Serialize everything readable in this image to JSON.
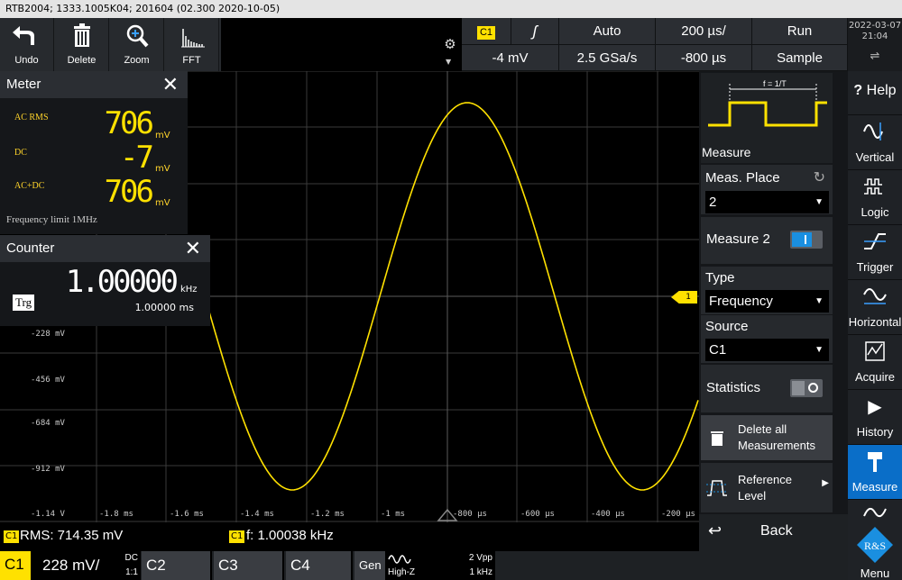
{
  "titlebar": {
    "text": "RTB2004; 1333.1005K04; 201604 (02.300 2020-10-05)"
  },
  "toolbar": {
    "undo": "Undo",
    "delete": "Delete",
    "zoom": "Zoom",
    "fft": "FFT"
  },
  "settings": {
    "channel": "C1",
    "slope_icon": "rising-edge-icon",
    "trigger_mode": "Auto",
    "timebase": "200 µs/",
    "run_state": "Run",
    "trigger_level": "-4 mV",
    "sample_rate": "2.5 GSa/s",
    "horizontal_position": "-800 µs",
    "acquire_mode": "Sample"
  },
  "datetime": {
    "date": "2022-03-07",
    "time": "21:04"
  },
  "grid": {
    "y_labels": [
      "-228 mV",
      "-456 mV",
      "-684 mV",
      "-912 mV",
      "-1.14 V"
    ],
    "x_labels": [
      "-1.8 ms",
      "-1.6 ms",
      "-1.4 ms",
      "-1.2 ms",
      "-1 ms",
      "-800 µs",
      "-600 µs",
      "-400 µs",
      "-200 µs"
    ],
    "trigger_marker": "1"
  },
  "meter": {
    "title": "Meter",
    "ac_rms_label": "AC RMS",
    "ac_rms_value": "706",
    "ac_rms_unit": "mV",
    "dc_label": "DC",
    "dc_value": "-7",
    "dc_unit": "mV",
    "acdc_label": "AC+DC",
    "acdc_value": "706",
    "acdc_unit": "mV",
    "freq_limit": "Frequency limit 1MHz"
  },
  "counter": {
    "title": "Counter",
    "trg": "Trg",
    "value": "1.00000",
    "unit": "kHz",
    "period": "1.00000 ms"
  },
  "menu": {
    "pulse_label": "f = 1/T",
    "title": "Measure",
    "meas_place_label": "Meas. Place",
    "meas_place_value": "2",
    "measure2_label": "Measure 2",
    "type_label": "Type",
    "type_value": "Frequency",
    "source_label": "Source",
    "source_value": "C1",
    "statistics_label": "Statistics",
    "delete_all": "Delete all Measurements",
    "reference_level": "Reference Level",
    "back": "Back"
  },
  "rightbar": {
    "help": "Help",
    "items": [
      "Vertical",
      "Logic",
      "Trigger",
      "Horizontal",
      "Acquire",
      "History",
      "Measure"
    ],
    "menu": "Menu"
  },
  "status": {
    "m1_channel": "C1",
    "m1_text": "RMS: 714.35 mV",
    "m2_channel": "C1",
    "m2_text": "f: 1.00038 kHz"
  },
  "bottom": {
    "c1": "C1",
    "c1_scale": "228 mV/",
    "c1_coupling": "DC",
    "c1_probe": "1:1",
    "c2": "C2",
    "c3": "C3",
    "c4": "C4",
    "gen": "Gen",
    "gen_mode": "High-Z",
    "gen_vpp": "2 Vpp",
    "gen_freq": "1 kHz"
  },
  "colors": {
    "channel1": "#ffe100",
    "accent": "#1a8fe0",
    "selected": "#0a6ec8"
  }
}
